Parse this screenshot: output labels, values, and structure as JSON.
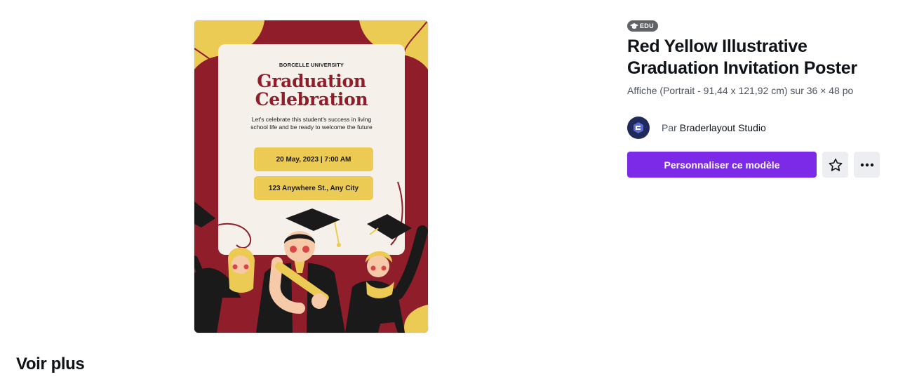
{
  "poster": {
    "university": "BORCELLE UNIVERSITY",
    "headline_line1": "Graduation",
    "headline_line2": "Celebration",
    "body": "Let's celebrate this student's success in living school life and be ready to welcome the future",
    "date": "20 May, 2023 | 7:00 AM",
    "address": "123 Anywhere St., Any City",
    "colors": {
      "red": "#8f1d2a",
      "yellow": "#eccb55",
      "cream": "#f5f1ea"
    }
  },
  "details": {
    "badge": "EDU",
    "badge_icon": "graduation-cap-icon",
    "title": "Red Yellow Illustrative Graduation Invitation Poster",
    "subtitle": "Affiche (Portrait - 91,44 x 121,92 cm) sur 36 × 48 po",
    "author_prefix": "Par",
    "author_name": "Braderlayout Studio",
    "cta_label": "Personnaliser ce modèle",
    "favorite_icon": "star-icon",
    "more_icon": "more-horizontal-icon",
    "accent_color": "#7d2ae8"
  },
  "see_more": "Voir plus"
}
